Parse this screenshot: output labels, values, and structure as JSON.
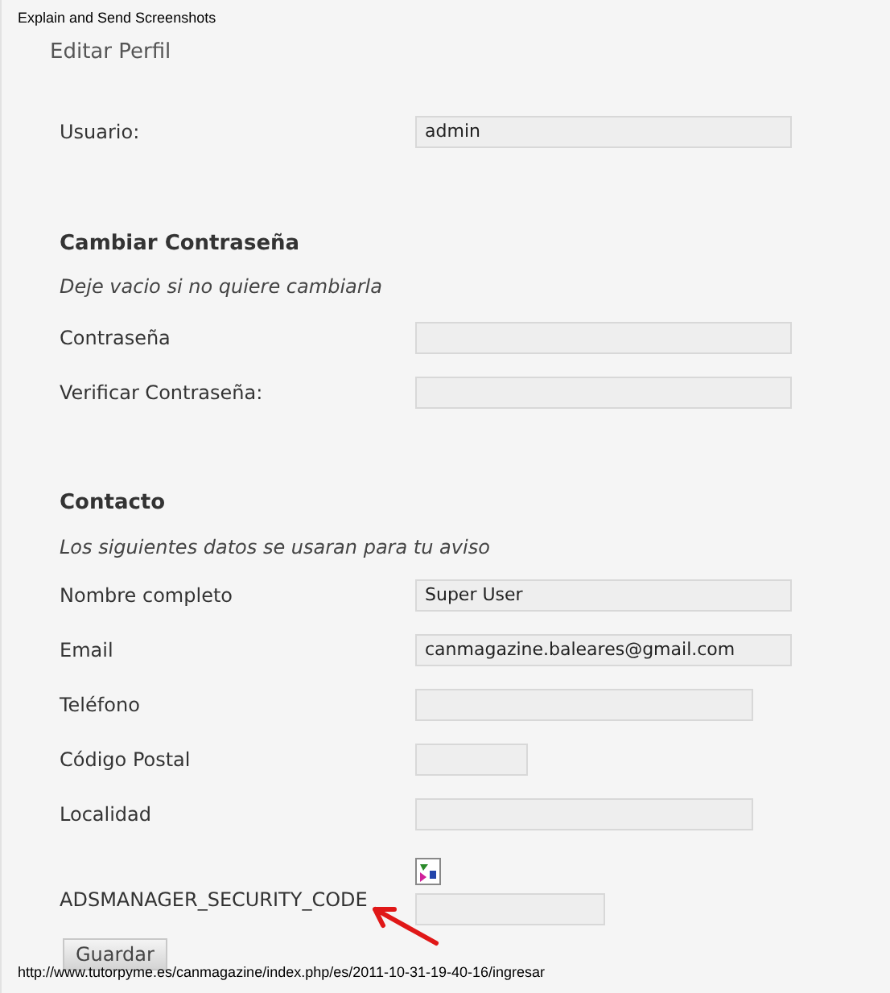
{
  "window": {
    "title": "Explain and Send Screenshots"
  },
  "page_title": "Editar Perfil",
  "account": {
    "fields": [
      {
        "label": "Usuario:",
        "value": "admin"
      }
    ]
  },
  "password_section": {
    "heading": "Cambiar Contraseña",
    "note": "Deje vacio si no quiere cambiarla",
    "fields": [
      {
        "label": "Contraseña"
      },
      {
        "label": "Verificar Contraseña:"
      }
    ]
  },
  "contact_section": {
    "heading": "Contacto",
    "note": "Los siguientes datos se usaran para tu aviso",
    "fields": [
      {
        "label": "Nombre completo",
        "value": "Super User"
      },
      {
        "label": "Email",
        "value": "canmagazine.baleares@gmail.com"
      },
      {
        "label": "Teléfono"
      },
      {
        "label": "Código Postal"
      },
      {
        "label": "Localidad"
      }
    ]
  },
  "security": {
    "label": "ADSMANAGER_SECURITY_CODE"
  },
  "save_button": "Guardar",
  "status_url": "http://www.tutorpyme.es/canmagazine/index.php/es/2011-10-31-19-40-16/ingresar"
}
